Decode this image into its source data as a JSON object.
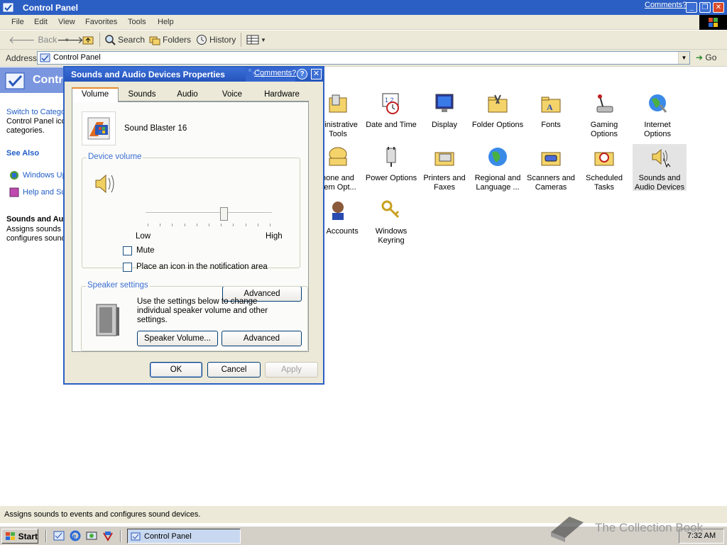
{
  "window": {
    "title": "Control Panel",
    "comments_link": "Comments?",
    "min_label": "_",
    "restore_label": "❐",
    "close_label": "✕"
  },
  "menu": [
    "File",
    "Edit",
    "View",
    "Favorites",
    "Tools",
    "Help"
  ],
  "toolbar": {
    "back": "Back",
    "search": "Search",
    "folders": "Folders",
    "history": "History"
  },
  "address": {
    "label": "Address",
    "value": "Control Panel",
    "go": "Go"
  },
  "left_panel": {
    "header": "Contr",
    "switch_category": "Switch to Catego",
    "desc_line1": "Control Panel ico",
    "desc_line2": "categories.",
    "see_also": "See Also",
    "links": [
      "Windows Up",
      "Help and Su"
    ],
    "details_title": "Sounds and Au",
    "details_line1": "Assigns sounds t",
    "details_line2": "configures sound"
  },
  "icons": [
    {
      "line1": "ministrative",
      "line2": "Tools"
    },
    {
      "line1": "Date and Time",
      "line2": ""
    },
    {
      "line1": "Display",
      "line2": ""
    },
    {
      "line1": "Folder Options",
      "line2": ""
    },
    {
      "line1": "Fonts",
      "line2": ""
    },
    {
      "line1": "Gaming",
      "line2": "Options"
    },
    {
      "line1": "Internet",
      "line2": "Options"
    },
    {
      "line1": "hone and",
      "line2": "dem Opt..."
    },
    {
      "line1": "Power Options",
      "line2": ""
    },
    {
      "line1": "Printers and",
      "line2": "Faxes"
    },
    {
      "line1": "Regional and",
      "line2": "Language ..."
    },
    {
      "line1": "Scanners and",
      "line2": "Cameras"
    },
    {
      "line1": "Scheduled",
      "line2": "Tasks"
    },
    {
      "line1": "Sounds and",
      "line2": "Audio Devices"
    },
    {
      "line1": "er Accounts",
      "line2": ""
    },
    {
      "line1": "Windows",
      "line2": "Keyring"
    }
  ],
  "status": "Assigns sounds to events and configures sound devices.",
  "taskbar": {
    "start": "Start",
    "active_task": "Control Panel",
    "clock": "7:32 AM"
  },
  "watermark": "The Collection Book",
  "dialog": {
    "title": "Sounds and Audio Devices Properties",
    "comments": "Comments?",
    "help": "?",
    "close": "✕",
    "tabs": [
      "Volume",
      "Sounds",
      "Audio",
      "Voice",
      "Hardware"
    ],
    "active_tab": "Volume",
    "device_name": "Sound Blaster 16",
    "device_volume_label": "Device volume",
    "volume_level": 0.62,
    "low": "Low",
    "high": "High",
    "mute": "Mute",
    "mute_checked": false,
    "notify_icon": "Place an icon in the notification area",
    "notify_checked": false,
    "advanced1": "Advanced",
    "speaker_settings_label": "Speaker settings",
    "speaker_desc": "Use the settings below to change individual speaker volume and other settings.",
    "speaker_volume_btn": "Speaker Volume...",
    "advanced2": "Advanced",
    "ok": "OK",
    "cancel": "Cancel",
    "apply": "Apply"
  }
}
